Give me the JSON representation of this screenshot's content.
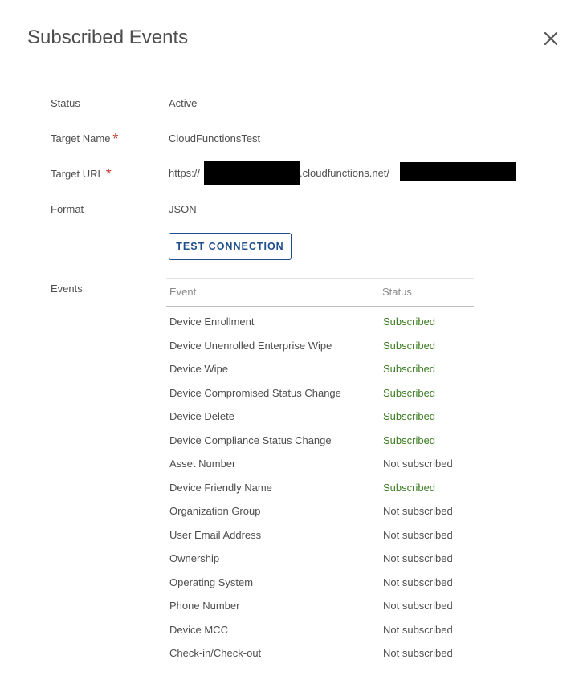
{
  "dialog": {
    "title": "Subscribed Events",
    "close_icon": "close-icon"
  },
  "fields": {
    "status": {
      "label": "Status",
      "value": "Active"
    },
    "target_name": {
      "label": "Target Name",
      "required_mark": "*",
      "value": "CloudFunctionsTest"
    },
    "target_url": {
      "label": "Target URL",
      "required_mark": "*",
      "prefix": "https://",
      "middle": ".cloudfunctions.net/",
      "redacted": true
    },
    "format": {
      "label": "Format",
      "value": "JSON"
    }
  },
  "test_connection": {
    "label": "TEST CONNECTION"
  },
  "events": {
    "label": "Events",
    "columns": {
      "event": "Event",
      "status": "Status"
    },
    "rows": [
      {
        "event": "Device Enrollment",
        "status": "Subscribed"
      },
      {
        "event": "Device Unenrolled Enterprise Wipe",
        "status": "Subscribed"
      },
      {
        "event": "Device Wipe",
        "status": "Subscribed"
      },
      {
        "event": "Device Compromised Status Change",
        "status": "Subscribed"
      },
      {
        "event": "Device Delete",
        "status": "Subscribed"
      },
      {
        "event": "Device Compliance Status Change",
        "status": "Subscribed"
      },
      {
        "event": "Asset Number",
        "status": "Not subscribed"
      },
      {
        "event": "Device Friendly Name",
        "status": "Subscribed"
      },
      {
        "event": "Organization Group",
        "status": "Not subscribed"
      },
      {
        "event": "User Email Address",
        "status": "Not subscribed"
      },
      {
        "event": "Ownership",
        "status": "Not subscribed"
      },
      {
        "event": "Operating System",
        "status": "Not subscribed"
      },
      {
        "event": "Phone Number",
        "status": "Not subscribed"
      },
      {
        "event": "Device MCC",
        "status": "Not subscribed"
      },
      {
        "event": "Check-in/Check-out",
        "status": "Not subscribed"
      }
    ]
  },
  "colors": {
    "subscribed": "#3d7d22",
    "required": "#c0392b",
    "button": "#1f4e8c"
  }
}
